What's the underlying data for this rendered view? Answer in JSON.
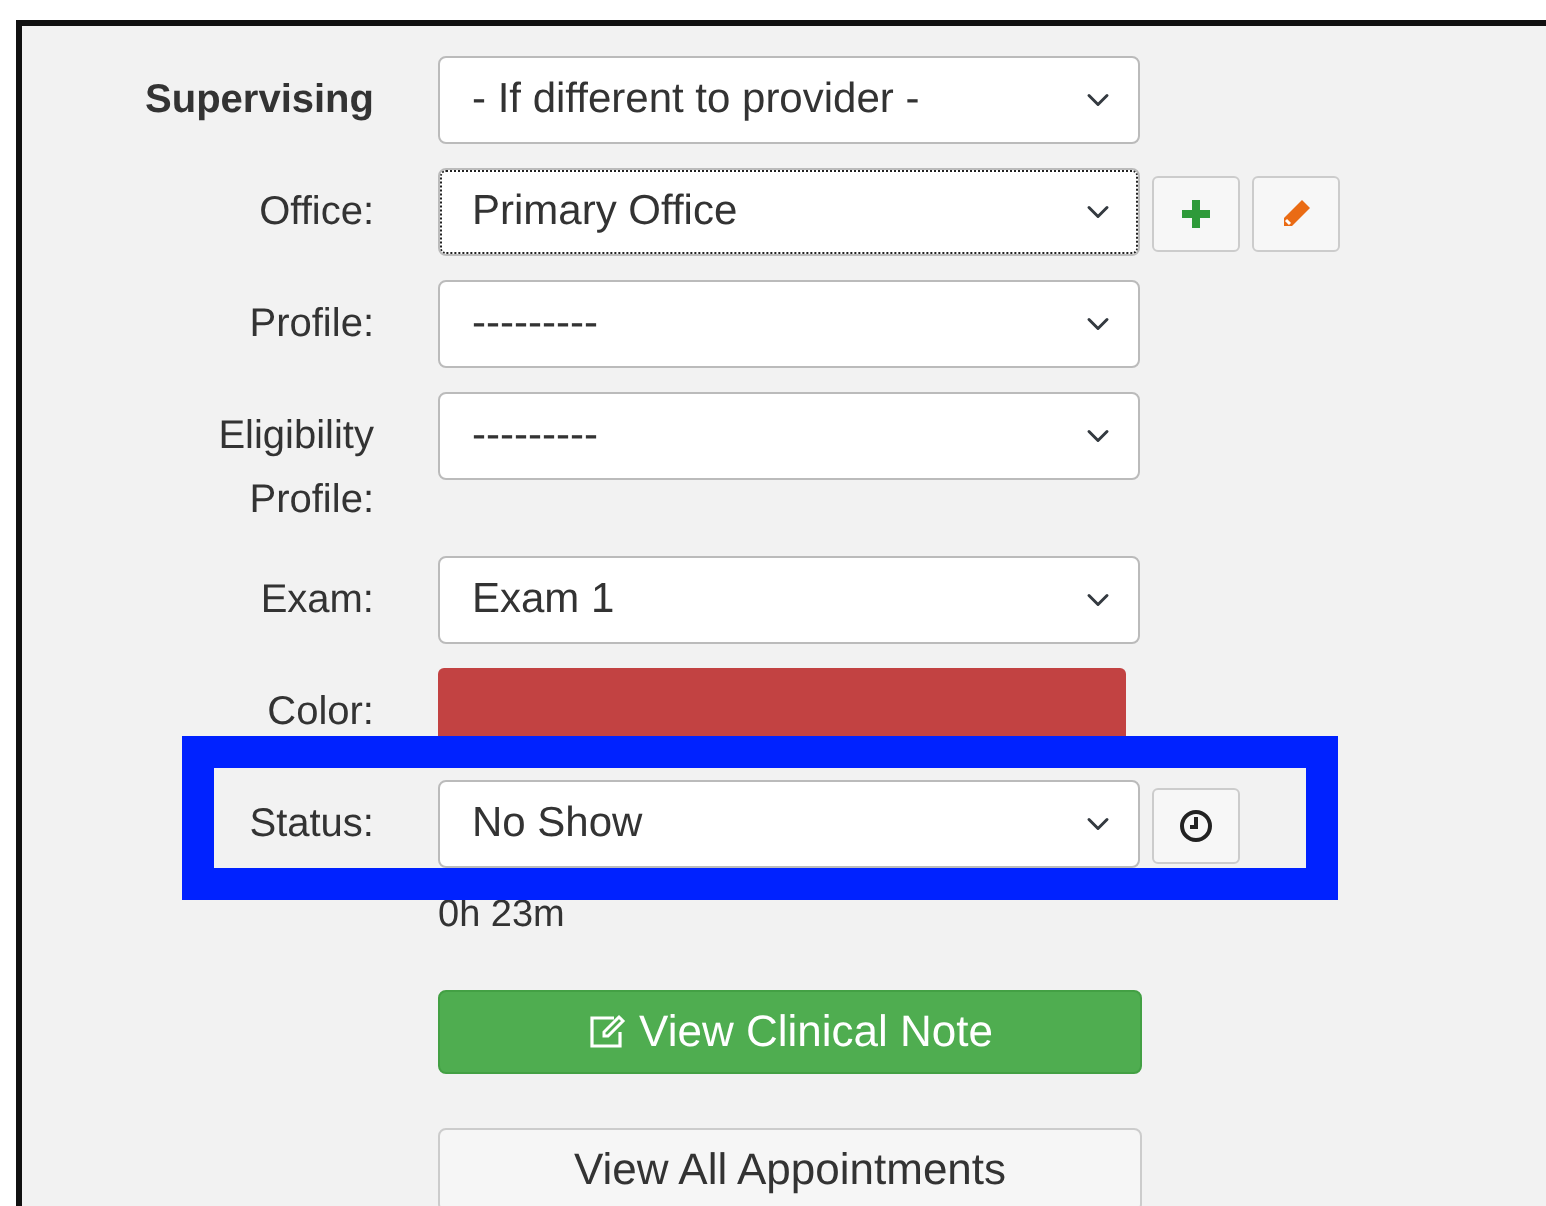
{
  "fields": [
    {
      "kind": "select",
      "label": "Supervising",
      "bold": true,
      "value": "- If different to provider -",
      "focused": false,
      "highlighted": false
    },
    {
      "kind": "select",
      "label": "Office:",
      "bold": false,
      "value": "Primary Office",
      "focused": true,
      "highlighted": false,
      "actions": [
        {
          "kind": "add"
        },
        {
          "kind": "edit"
        }
      ]
    },
    {
      "kind": "select",
      "label": "Profile:",
      "bold": false,
      "value": "---------",
      "focused": false,
      "highlighted": false
    },
    {
      "kind": "select",
      "label": "Eligibility Profile:",
      "bold": false,
      "value": "---------",
      "focused": false,
      "highlighted": false
    },
    {
      "kind": "select",
      "label": "Exam:",
      "bold": false,
      "value": "Exam 1",
      "focused": false,
      "highlighted": false
    },
    {
      "kind": "color",
      "label": "Color:",
      "color": "#c24242"
    },
    {
      "kind": "select",
      "label": "Status:",
      "bold": false,
      "value": "No Show",
      "focused": false,
      "highlighted": true,
      "actions": [
        {
          "kind": "clock"
        }
      ]
    }
  ],
  "elapsed": "0h 23m",
  "buttons": [
    {
      "label": "View Clinical Note",
      "kind": "success"
    },
    {
      "label": "View All Appointments",
      "kind": "default"
    }
  ]
}
